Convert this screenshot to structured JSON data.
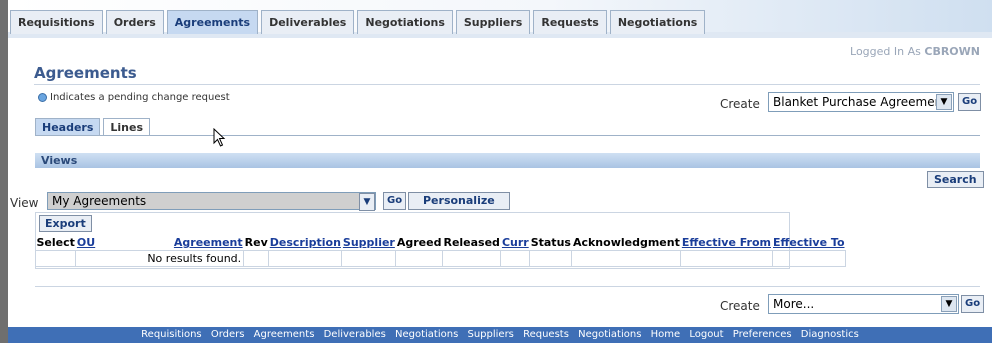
{
  "tabs": [
    {
      "label": "Requisitions",
      "active": false
    },
    {
      "label": "Orders",
      "active": false
    },
    {
      "label": "Agreements",
      "active": true
    },
    {
      "label": "Deliverables",
      "active": false
    },
    {
      "label": "Negotiations",
      "active": false
    },
    {
      "label": "Suppliers",
      "active": false
    },
    {
      "label": "Requests",
      "active": false
    },
    {
      "label": "Negotiations",
      "active": false
    }
  ],
  "header": {
    "logged_in_prefix": "Logged In As",
    "user": "CBROWN"
  },
  "page": {
    "title": "Agreements",
    "pending_note": "Indicates a pending change request"
  },
  "create_top": {
    "label": "Create",
    "selected": "Blanket Purchase Agreement",
    "go": "Go"
  },
  "subtabs": [
    {
      "label": "Headers",
      "active": true
    },
    {
      "label": "Lines",
      "active": false
    }
  ],
  "views": {
    "bar_title": "Views",
    "search_label": "Search",
    "view_label": "View",
    "view_selected": "My Agreements",
    "go": "Go",
    "personalize_label": "Personalize"
  },
  "results": {
    "export_label": "Export",
    "columns": [
      {
        "label": "Select",
        "link": false
      },
      {
        "label": "OU",
        "link": true
      },
      {
        "label": "Agreement",
        "link": true
      },
      {
        "label": "Rev",
        "link": false
      },
      {
        "label": "Description",
        "link": true
      },
      {
        "label": "Supplier",
        "link": true
      },
      {
        "label": "Agreed",
        "link": false
      },
      {
        "label": "Released",
        "link": false
      },
      {
        "label": "Curr",
        "link": true
      },
      {
        "label": "Status",
        "link": false
      },
      {
        "label": "Acknowledgment",
        "link": false
      },
      {
        "label": "Effective From",
        "link": true
      },
      {
        "label": "Effective To",
        "link": true
      }
    ],
    "empty_message": "No results found."
  },
  "create_bottom": {
    "label": "Create",
    "selected": "More...",
    "go": "Go"
  },
  "footer_links": [
    "Requisitions",
    "Orders",
    "Agreements",
    "Deliverables",
    "Negotiations",
    "Suppliers",
    "Requests",
    "Negotiations",
    "Home",
    "Logout",
    "Preferences",
    "Diagnostics"
  ],
  "colors": {
    "accent": "#3c5b8f",
    "footer": "#3f6fb6",
    "link": "#1a3d9a"
  }
}
